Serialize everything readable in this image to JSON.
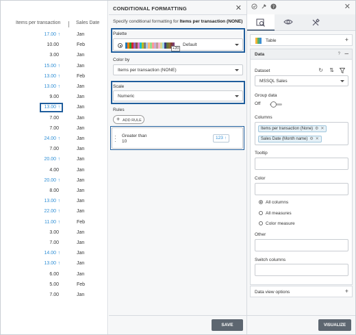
{
  "table": {
    "col1_header": "Items per transaction",
    "col2_header": "Sales Date",
    "rows": [
      {
        "value": "17.00",
        "arrow": "↑",
        "month": "Jan"
      },
      {
        "value": "10.00",
        "arrow": "",
        "month": "Feb"
      },
      {
        "value": "3.00",
        "arrow": "",
        "month": "Jan"
      },
      {
        "value": "15.00",
        "arrow": "↑",
        "month": "Jan"
      },
      {
        "value": "13.00",
        "arrow": "↑",
        "month": "Feb"
      },
      {
        "value": "13.00",
        "arrow": "↑",
        "month": "Jan"
      },
      {
        "value": "9.00",
        "arrow": "",
        "month": "Jan"
      },
      {
        "value": "13.00",
        "arrow": "↑",
        "month": "Jan"
      },
      {
        "value": "7.00",
        "arrow": "",
        "month": "Jan"
      },
      {
        "value": "7.00",
        "arrow": "",
        "month": "Jan"
      },
      {
        "value": "24.00",
        "arrow": "↑",
        "month": "Jan"
      },
      {
        "value": "7.00",
        "arrow": "",
        "month": "Jan"
      },
      {
        "value": "20.00",
        "arrow": "↑",
        "month": "Jan"
      },
      {
        "value": "4.00",
        "arrow": "",
        "month": "Jan"
      },
      {
        "value": "20.00",
        "arrow": "↑",
        "month": "Jan"
      },
      {
        "value": "8.00",
        "arrow": "",
        "month": "Jan"
      },
      {
        "value": "13.00",
        "arrow": "↑",
        "month": "Jan"
      },
      {
        "value": "22.00",
        "arrow": "↑",
        "month": "Jan"
      },
      {
        "value": "11.00",
        "arrow": "↑",
        "month": "Feb"
      },
      {
        "value": "3.00",
        "arrow": "",
        "month": "Jan"
      },
      {
        "value": "7.00",
        "arrow": "",
        "month": "Jan"
      },
      {
        "value": "14.00",
        "arrow": "↑",
        "month": "Jan"
      },
      {
        "value": "13.00",
        "arrow": "↑",
        "month": "Jan"
      },
      {
        "value": "6.00",
        "arrow": "",
        "month": "Jan"
      },
      {
        "value": "5.00",
        "arrow": "",
        "month": "Feb"
      },
      {
        "value": "7.00",
        "arrow": "",
        "month": "Jan"
      }
    ]
  },
  "cf": {
    "title": "CONDITIONAL FORMATTING",
    "desc_prefix": "Specify conditional formatting for ",
    "desc_bold": "Items per transaction (NONE)",
    "palette_label": "Palette",
    "palette_more": "+20",
    "palette_value": "Default",
    "palette_colors": [
      "#1f77b4",
      "#ff7f0e",
      "#2ca02c",
      "#d62728",
      "#9467bd",
      "#8c564b",
      "#e377c2",
      "#17becf",
      "#bcbd22",
      "#7f7f7f",
      "#aec7e8",
      "#ffbb78",
      "#98df8a",
      "#ff9896",
      "#c5b0d5",
      "#c49c94",
      "#f7b6d2",
      "#dbdb8d",
      "#9edae5",
      "#393b79",
      "#637939",
      "#8c6d31",
      "#843c39",
      "#7b4173"
    ],
    "colorby_label": "Color by",
    "colorby_value": "Items per transaction (NONE)",
    "scale_label": "Scale",
    "scale_value": "Numeric",
    "rules_label": "Rules",
    "add_rule_label": "ADD RULE",
    "rule_line1": "Greater than",
    "rule_line2": "10",
    "rule_badge": "123 ↑",
    "save_label": "SAVE"
  },
  "right": {
    "table_label": "Table",
    "data_label": "Data",
    "data_help": "?",
    "dataset_label": "Dataset",
    "dataset_value": "MSSQL Sales",
    "group_label": "Group data",
    "group_state": "Off",
    "columns_label": "Columns",
    "chips": [
      "Items per transaction (None)",
      "Sales Date (Month name)"
    ],
    "tooltip_label": "Tooltip",
    "color_label": "Color",
    "radio_all_columns": "All columns",
    "radio_all_measures": "All measures",
    "radio_color_measure": "Color measure",
    "other_label": "Other",
    "switch_label": "Switch columns",
    "dvo_label": "Data view options",
    "visualize_label": "VISUALIZE"
  },
  "colors": {
    "accent": "#1f5d9c",
    "up_value": "#2f8fd6",
    "button": "#5d6670"
  }
}
